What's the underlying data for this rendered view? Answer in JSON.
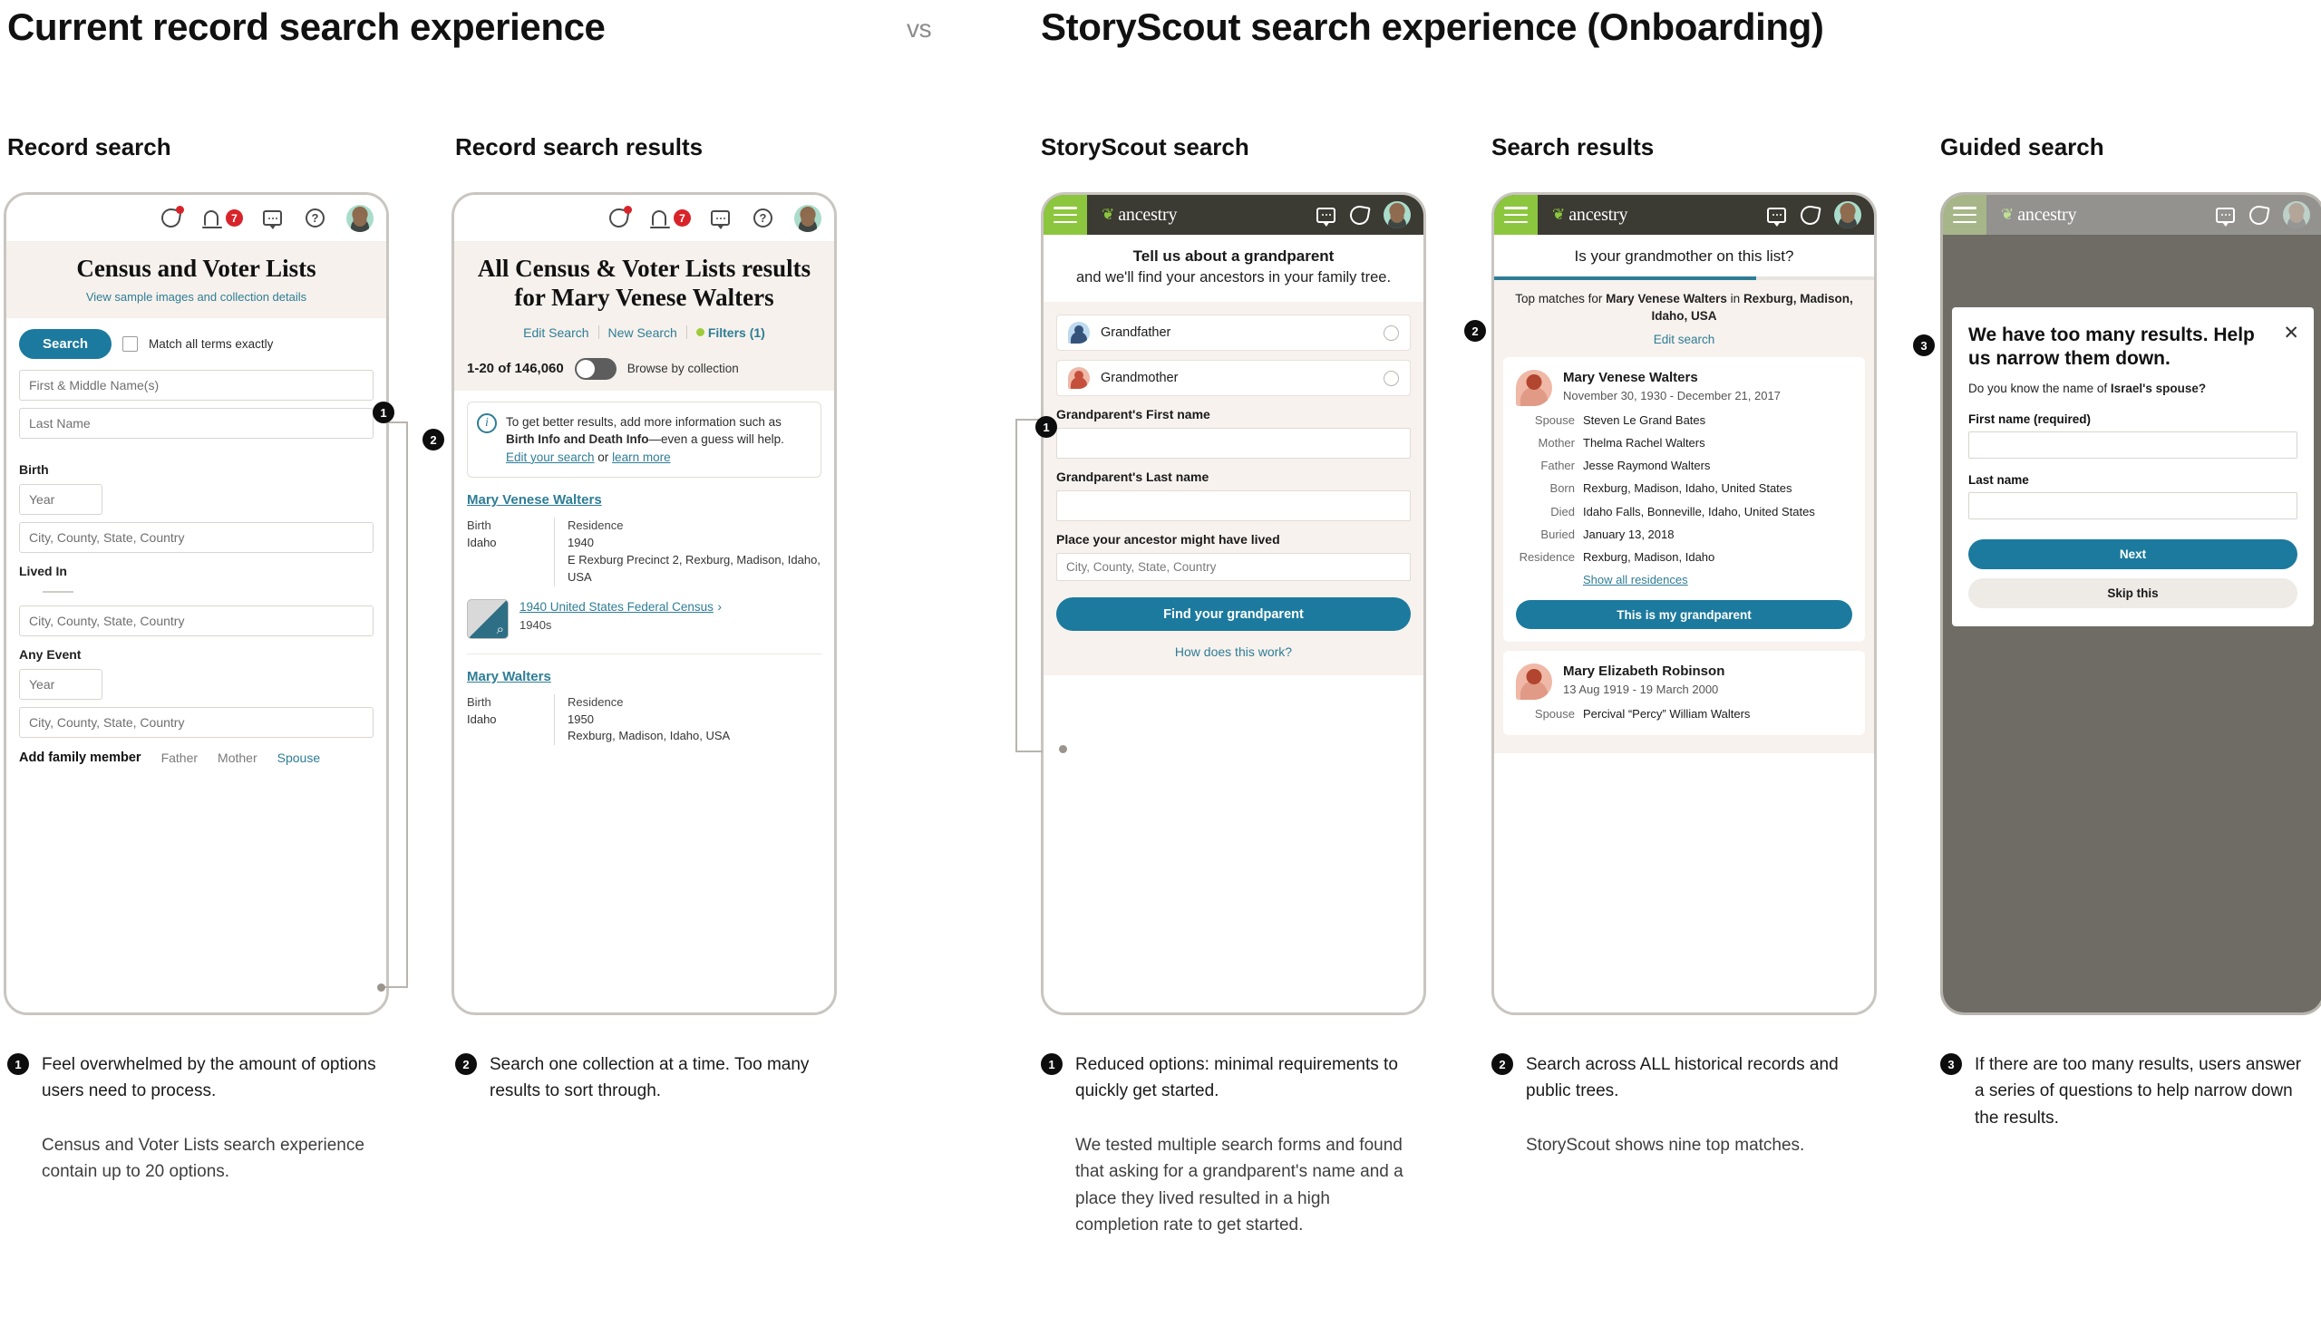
{
  "headings": {
    "left": "Current record search experience",
    "vs": "vs",
    "right": "StoryScout search experience (Onboarding)"
  },
  "columns": [
    {
      "title": "Record search"
    },
    {
      "title": "Record search results"
    },
    {
      "title": "StoryScout search"
    },
    {
      "title": "Search results"
    },
    {
      "title": "Guided search"
    }
  ],
  "record_search": {
    "statusbar": {
      "notification_badge": "7",
      "help_icon": "?"
    },
    "hero_title": "Census and Voter Lists",
    "hero_link": "View sample images and collection details",
    "search_button": "Search",
    "match_all_label": "Match all terms exactly",
    "first_name_placeholder": "First & Middle Name(s)",
    "last_name_placeholder": "Last Name",
    "birth_label": "Birth",
    "birth_year_placeholder": "Year",
    "birth_place_placeholder": "City, County, State, Country",
    "lived_in_label": "Lived In",
    "lived_in_place_placeholder": "City, County, State, Country",
    "any_event_label": "Any Event",
    "any_event_year_placeholder": "Year",
    "any_event_place_placeholder": "City, County, State, Country",
    "add_family_label": "Add family member",
    "family_options": [
      "Father",
      "Mother",
      "Spouse"
    ]
  },
  "record_results": {
    "hero_title": "All Census & Voter Lists results for Mary Venese Walters",
    "links": {
      "edit": "Edit Search",
      "new": "New Search",
      "filters": "Filters (1)"
    },
    "count": "1-20 of 146,060",
    "browse_label": "Browse by collection",
    "tip": {
      "text_1": "To get better results, add more information such as ",
      "bold_1": "Birth Info and Death Info",
      "text_2": "—even a guess will help.",
      "link_1": "Edit your search",
      "mid": " or ",
      "link_2": "learn more"
    },
    "hits": [
      {
        "name": "Mary Venese Walters",
        "left_head": "Birth",
        "left_value": "Idaho",
        "right_head": "Residence",
        "right_value": "1940\nE Rexburg Precinct 2, Rexburg, Madison, Idaho, USA",
        "source_link": "1940 United States Federal Census",
        "source_sub": "1940s"
      },
      {
        "name": "Mary Walters",
        "left_head": "Birth",
        "left_value": "Idaho",
        "right_head": "Residence",
        "right_value": "1950\nRexburg, Madison, Idaho, USA"
      }
    ]
  },
  "storyscout_search": {
    "brand": "ancestry",
    "headline_bold": "Tell us about a grandparent",
    "headline_rest": "and we'll find your ancestors in your family tree.",
    "options": [
      {
        "label": "Grandfather"
      },
      {
        "label": "Grandmother"
      }
    ],
    "first_name_label": "Grandparent's First name",
    "last_name_label": "Grandparent's Last name",
    "place_label": "Place your ancestor might have lived",
    "place_placeholder": "City, County, State, Country",
    "submit_button": "Find your grandparent",
    "help_link": "How does this work?"
  },
  "search_results": {
    "brand": "ancestry",
    "question": "Is your grandmother on this list?",
    "sub_prefix": "Top matches for ",
    "sub_name": "Mary Venese Walters",
    "sub_in": " in ",
    "sub_place": "Rexburg, Madison, Idaho, USA",
    "edit_link": "Edit search",
    "people": [
      {
        "name": "Mary Venese Walters",
        "dates": "November 30, 1930 - December 21, 2017",
        "facts": [
          {
            "key": "Spouse",
            "value": "Steven Le Grand Bates"
          },
          {
            "key": "Mother",
            "value": "Thelma Rachel Walters"
          },
          {
            "key": "Father",
            "value": "Jesse Raymond Walters"
          },
          {
            "key": "Born",
            "value": "Rexburg, Madison, Idaho, United States"
          },
          {
            "key": "Died",
            "value": "Idaho Falls, Bonneville, Idaho, United States"
          },
          {
            "key": "Buried",
            "value": "January 13, 2018"
          },
          {
            "key": "Residence",
            "value": "Rexburg, Madison, Idaho"
          }
        ],
        "show_all_link": "Show all residences",
        "claim_button": "This is my grandparent"
      },
      {
        "name": "Mary Elizabeth Robinson",
        "dates": "13 Aug 1919 - 19 March 2000",
        "facts": [
          {
            "key": "Spouse",
            "value": "Percival “Percy” William Walters"
          }
        ]
      }
    ]
  },
  "guided_search": {
    "brand": "ancestry",
    "modal_title": "We have too many results. Help us narrow them down.",
    "question_prefix": "Do you know the name of ",
    "question_bold": "Israel's spouse?",
    "first_name_label": "First name (required)",
    "last_name_label": "Last name",
    "next_button": "Next",
    "skip_button": "Skip this"
  },
  "captions": [
    {
      "num": "1",
      "text": "Feel overwhelmed by the amount of options users need to process.",
      "note": "Census and Voter Lists search experience contain up to 20 options."
    },
    {
      "num": "2",
      "text": "Search one collection at a time. Too many results to sort through.",
      "note": ""
    },
    {
      "num": "1",
      "text": "Reduced options: minimal requirements to quickly get started.",
      "note": "We tested multiple search forms and found that asking for a grandparent's name and a place they lived resulted in a high completion rate to get started."
    },
    {
      "num": "2",
      "text": "Search across ALL historical records and public trees.",
      "note": "StoryScout shows nine top matches."
    },
    {
      "num": "3",
      "text": "If there are too many results, users answer a series of questions to help narrow down the results.",
      "note": ""
    }
  ],
  "markers": {
    "m1": "1",
    "m2": "2",
    "m1b": "1",
    "m2b": "2",
    "m3": "3"
  },
  "colors": {
    "accent_teal": "#1c7a9e",
    "brand_green": "#8cc63e",
    "dark_bar": "#3b3a33",
    "red_badge": "#d8232a"
  }
}
